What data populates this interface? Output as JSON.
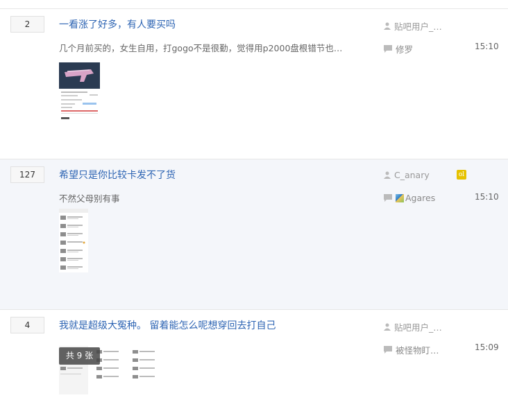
{
  "threads": [
    {
      "reply_count": "2",
      "title": "一看涨了好多，有人要买吗",
      "excerpt": "几个月前买的，女生自用，打gogo不是很勤，觉得用p2000盘根错节也和这…",
      "author": "贴吧用户_…",
      "last_replier": "修罗",
      "time": "15:10",
      "thumb_icon": "screenshot-thumbnail"
    },
    {
      "reply_count": "127",
      "title": "希望只是你比较卡发不了货",
      "excerpt": "不然父母别有事",
      "author": "C_anary",
      "author_badge": "ol",
      "last_replier": "Agares",
      "time": "15:10",
      "thumb_icon": "screenshot-thumbnail"
    },
    {
      "reply_count": "4",
      "title": "我就是超级大冤种。 留着能怎么呢想穿回去打自己",
      "author": "贴吧用户_…",
      "last_replier": "被怪物盯…",
      "time": "15:09",
      "pic_count_label": "共 9 张",
      "thumb_icon": "screenshot-thumbnail"
    }
  ],
  "colors": {
    "title": "#2d64b3",
    "alt_row_bg": "#f4f6fa",
    "badge": "#e6c200"
  }
}
